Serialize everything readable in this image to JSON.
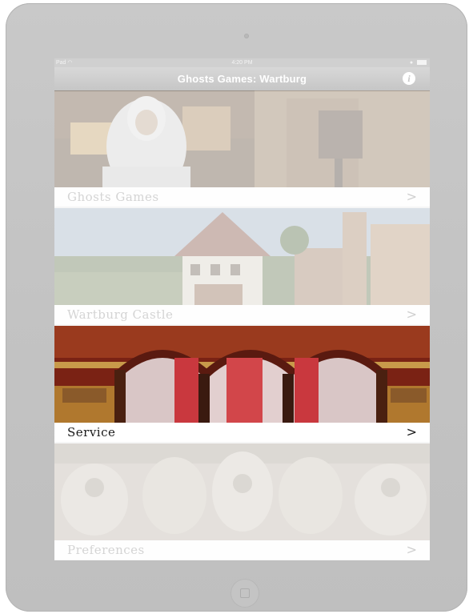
{
  "status_bar": {
    "device": "Pad",
    "wifi_icon": "wifi-icon",
    "time": "4:20 PM",
    "battery_icon": "battery-icon"
  },
  "nav": {
    "title": "Ghosts Games: Wartburg",
    "info_icon": "info-icon",
    "info_glyph": "i"
  },
  "menu": [
    {
      "label": "Ghosts Games",
      "chevron": ">",
      "active": false
    },
    {
      "label": "Wartburg Castle",
      "chevron": ">",
      "active": false
    },
    {
      "label": "Service",
      "chevron": ">",
      "active": true
    },
    {
      "label": "Preferences",
      "chevron": ">",
      "active": false
    }
  ],
  "colors": {
    "bezel": "#c3c3c3",
    "navbar": "#cccccc",
    "active_text": "#1a1a1a",
    "inactive_text": "#d4d4d4"
  }
}
